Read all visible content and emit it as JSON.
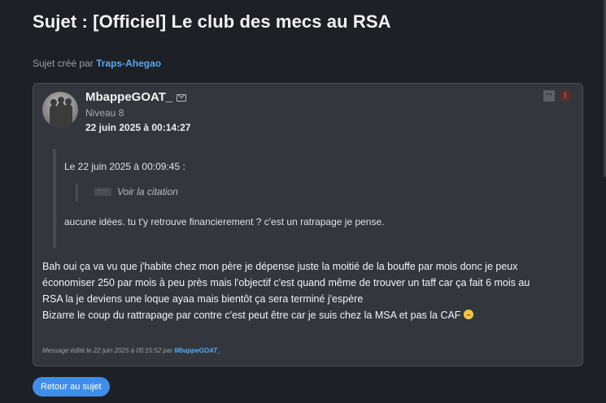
{
  "page": {
    "title": "Sujet : [Officiel] Le club des mecs au RSA",
    "created_by_label": "Sujet créé par",
    "created_by_author": "Traps-Ahegao"
  },
  "post": {
    "username": "MbappeGOAT_",
    "level": "Niveau 8",
    "date": "22 juin 2025 à 00:14:27",
    "quote": {
      "header": "Le 22 juin 2025 à 00:09:45 :",
      "dots": "···",
      "view_quote": "Voir la citation",
      "text": "aucune idées. tu t'y retrouve financierement ? c'est un ratrapage je pense."
    },
    "message_lines": [
      "Bah oui ça va vu que j'habite chez mon père je dépense juste la moitié de la bouffe par mois donc je peux",
      "économiser 250 par mois à peu près mais l'objectif c'est quand même de trouver un taff car ça fait 6 mois au",
      "RSA la je deviens une loque ayaa mais bientôt ça sera terminé j'espère",
      "Bizarre le coup du rattrapage par contre c'est peut être car je suis chez la MSA et pas la CAF"
    ],
    "emoji": "sad-face-emoji",
    "edit_note_prefix": "Message édité le 22 juin 2025 à 00:15:52 par",
    "edit_note_author": "MbappeGOAT_",
    "alert_glyph": "!"
  },
  "actions": {
    "back_label": "Retour au sujet"
  },
  "colors": {
    "background": "#1d2024",
    "card": "#33373d",
    "link": "#5aa7f0",
    "button": "#3f8ee9"
  }
}
